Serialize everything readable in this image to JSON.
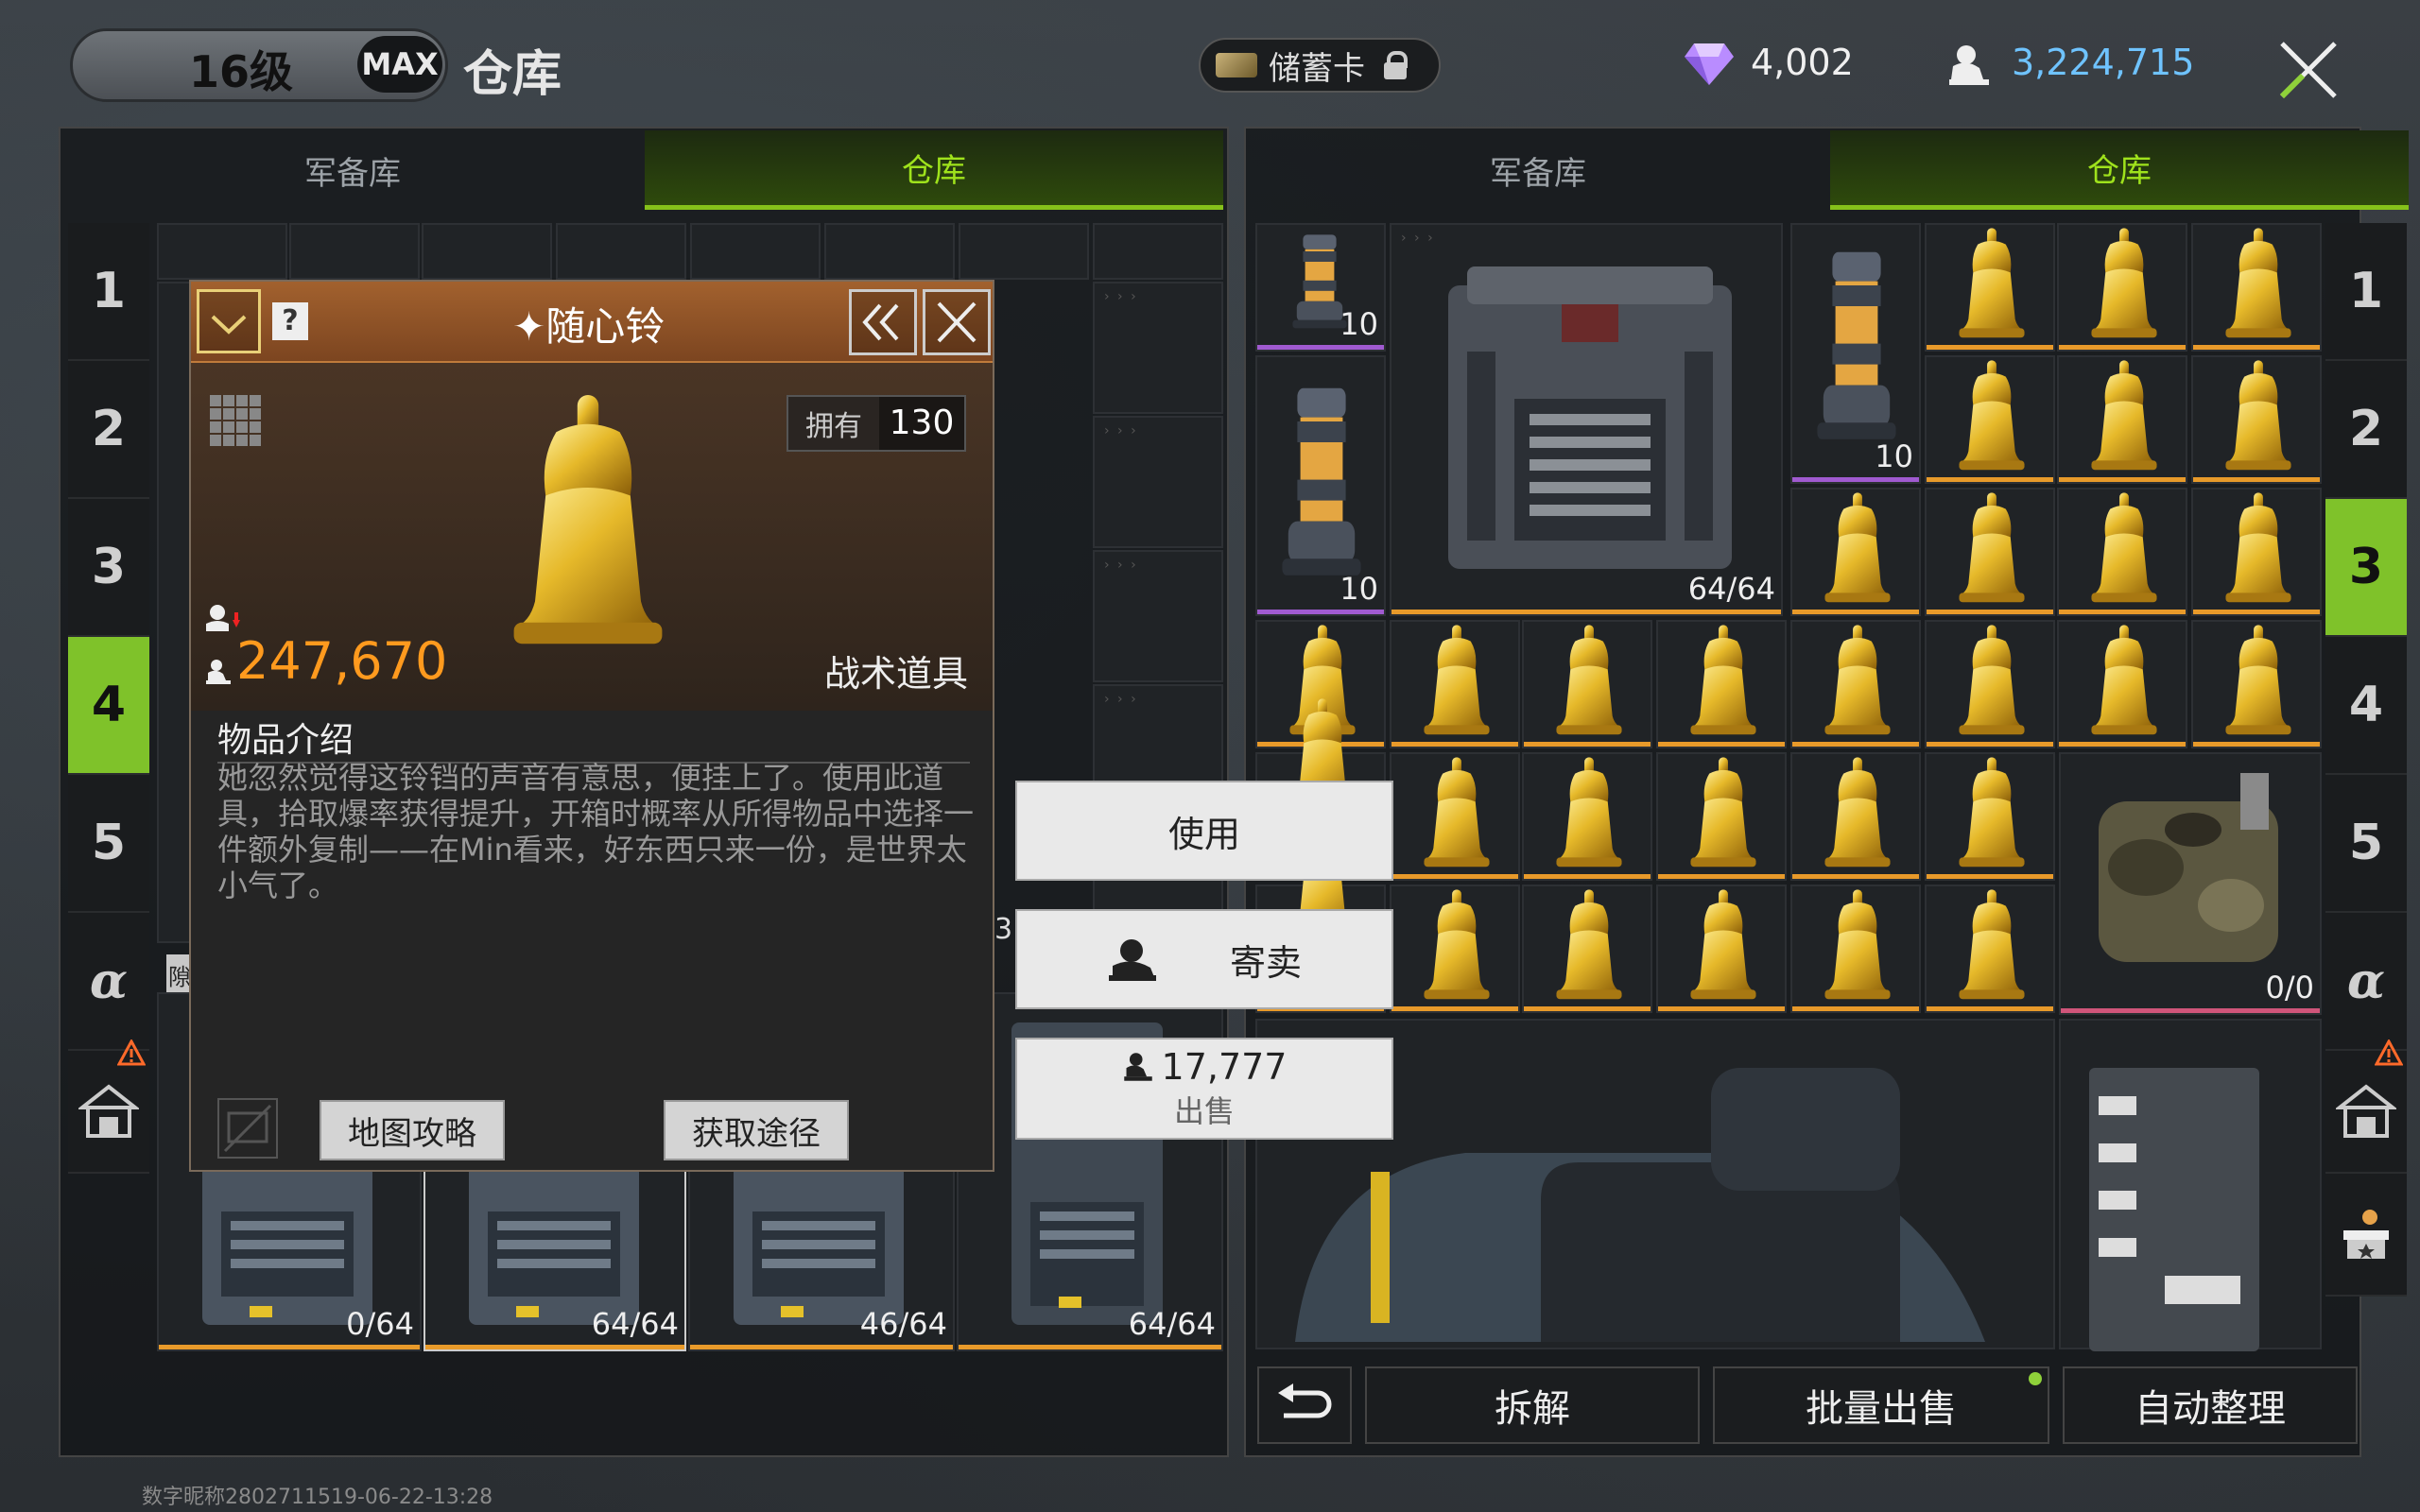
{
  "header": {
    "level": "16级",
    "max_badge": "MAX",
    "title": "仓库",
    "savings_card": "储蓄卡",
    "diamonds": "4,002",
    "coins": "3,224,715"
  },
  "left_panel": {
    "tabs": [
      "军备库",
      "仓库"
    ],
    "active_tab": 1,
    "side_numbers": [
      "1",
      "2",
      "3",
      "4",
      "5",
      "α"
    ],
    "active_number": 3,
    "bottom_slots": [
      {
        "count": "0/64"
      },
      {
        "count": "64/64"
      },
      {
        "count": "46/64"
      },
      {
        "count": "64/64"
      }
    ],
    "partial_label": "3",
    "partial_label2": "隙"
  },
  "right_panel": {
    "tabs": [
      "军备库",
      "仓库"
    ],
    "active_tab": 1,
    "side_numbers": [
      "1",
      "2",
      "3",
      "4",
      "5",
      "α"
    ],
    "active_number": 2,
    "canister_counts": [
      "10",
      "10",
      "10"
    ],
    "crate_count": "64/64",
    "backpack_count": "0/0"
  },
  "popup": {
    "title": "随心铃",
    "owned_label": "拥有",
    "owned_value": "130",
    "price": "247,670",
    "item_type": "战术道具",
    "description_title": "物品介绍",
    "description": "她忽然觉得这铃铛的声音有意思，便挂上了。使用此道具，拾取爆率获得提升，开箱时概率从所得物品中选择一件额外复制——在Min看来，好东西只来一份，是世界太小气了。",
    "btn_map": "地图攻略",
    "btn_source": "获取途径"
  },
  "actions": {
    "use": "使用",
    "consign": "寄卖",
    "sell_price": "17,777",
    "sell": "出售"
  },
  "bottom_bar": {
    "dismantle": "拆解",
    "bulk_sell": "批量出售",
    "auto_sort": "自动整理"
  },
  "watermark": "数字昵称2802711519-06-22-13:28",
  "colors": {
    "accent_green": "#86c21a",
    "price_orange": "#ff9a1e",
    "coin_blue": "#6fc3ff",
    "rarity_orange": "#e89a2a"
  }
}
